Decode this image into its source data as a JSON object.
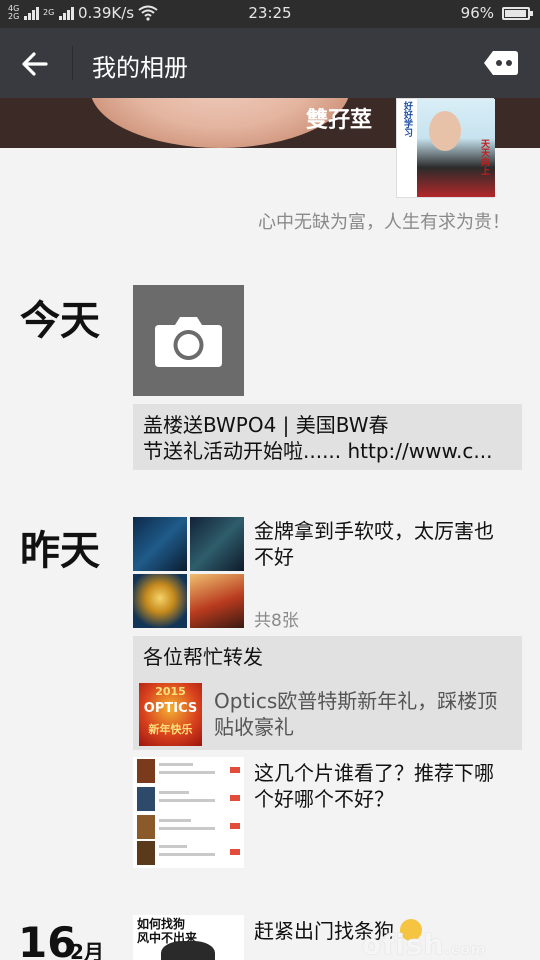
{
  "status_bar": {
    "network_left": "4G",
    "network_left_sub": "2G",
    "network_right": "2G",
    "speed": "0.39K/s",
    "time": "23:25",
    "battery": "96%",
    "battery_level": 0.96
  },
  "header": {
    "back_icon": "arrow-left-icon",
    "title": "我的相册",
    "more_icon": "more-dots-icon"
  },
  "profile": {
    "name": "雙孖莖",
    "avatar_caption_left": "好好学习",
    "avatar_caption_right": "天天向上",
    "signature": "心中无缺为富，人生有求为贵！"
  },
  "timeline": {
    "today": {
      "day": "今天",
      "camera_icon": "camera-icon",
      "share_line1": "盖楼送BWPO4 | 美国BW春",
      "share_line2": "节送礼活动开始啦...... http://www.c..."
    },
    "yesterday": {
      "day": "昨天",
      "post1_line1": "金牌拿到手软哎，太厉害也",
      "post1_line2": "不好",
      "post1_count": "共8张",
      "share_title": "各位帮忙转发",
      "share_ad_line1": "Optics欧普特斯新年礼，踩楼顶",
      "share_ad_line2": "贴收豪礼",
      "ad_thumb_line1": "2015",
      "ad_thumb_line2": "OPTICS",
      "ad_thumb_line3": "新年快乐",
      "post2_line1": "这几个片谁看了？推荐下哪",
      "post2_line2": "个好哪个不好？"
    },
    "feb16": {
      "day": "16",
      "month": "2月",
      "thumb_line1": "如何找狗",
      "thumb_line2": "风中不出来",
      "post_text": "赶紧出门找条狗",
      "emoji": "grin-emoji"
    }
  },
  "watermark": {
    "main": "ofish",
    "suffix": ".com"
  }
}
